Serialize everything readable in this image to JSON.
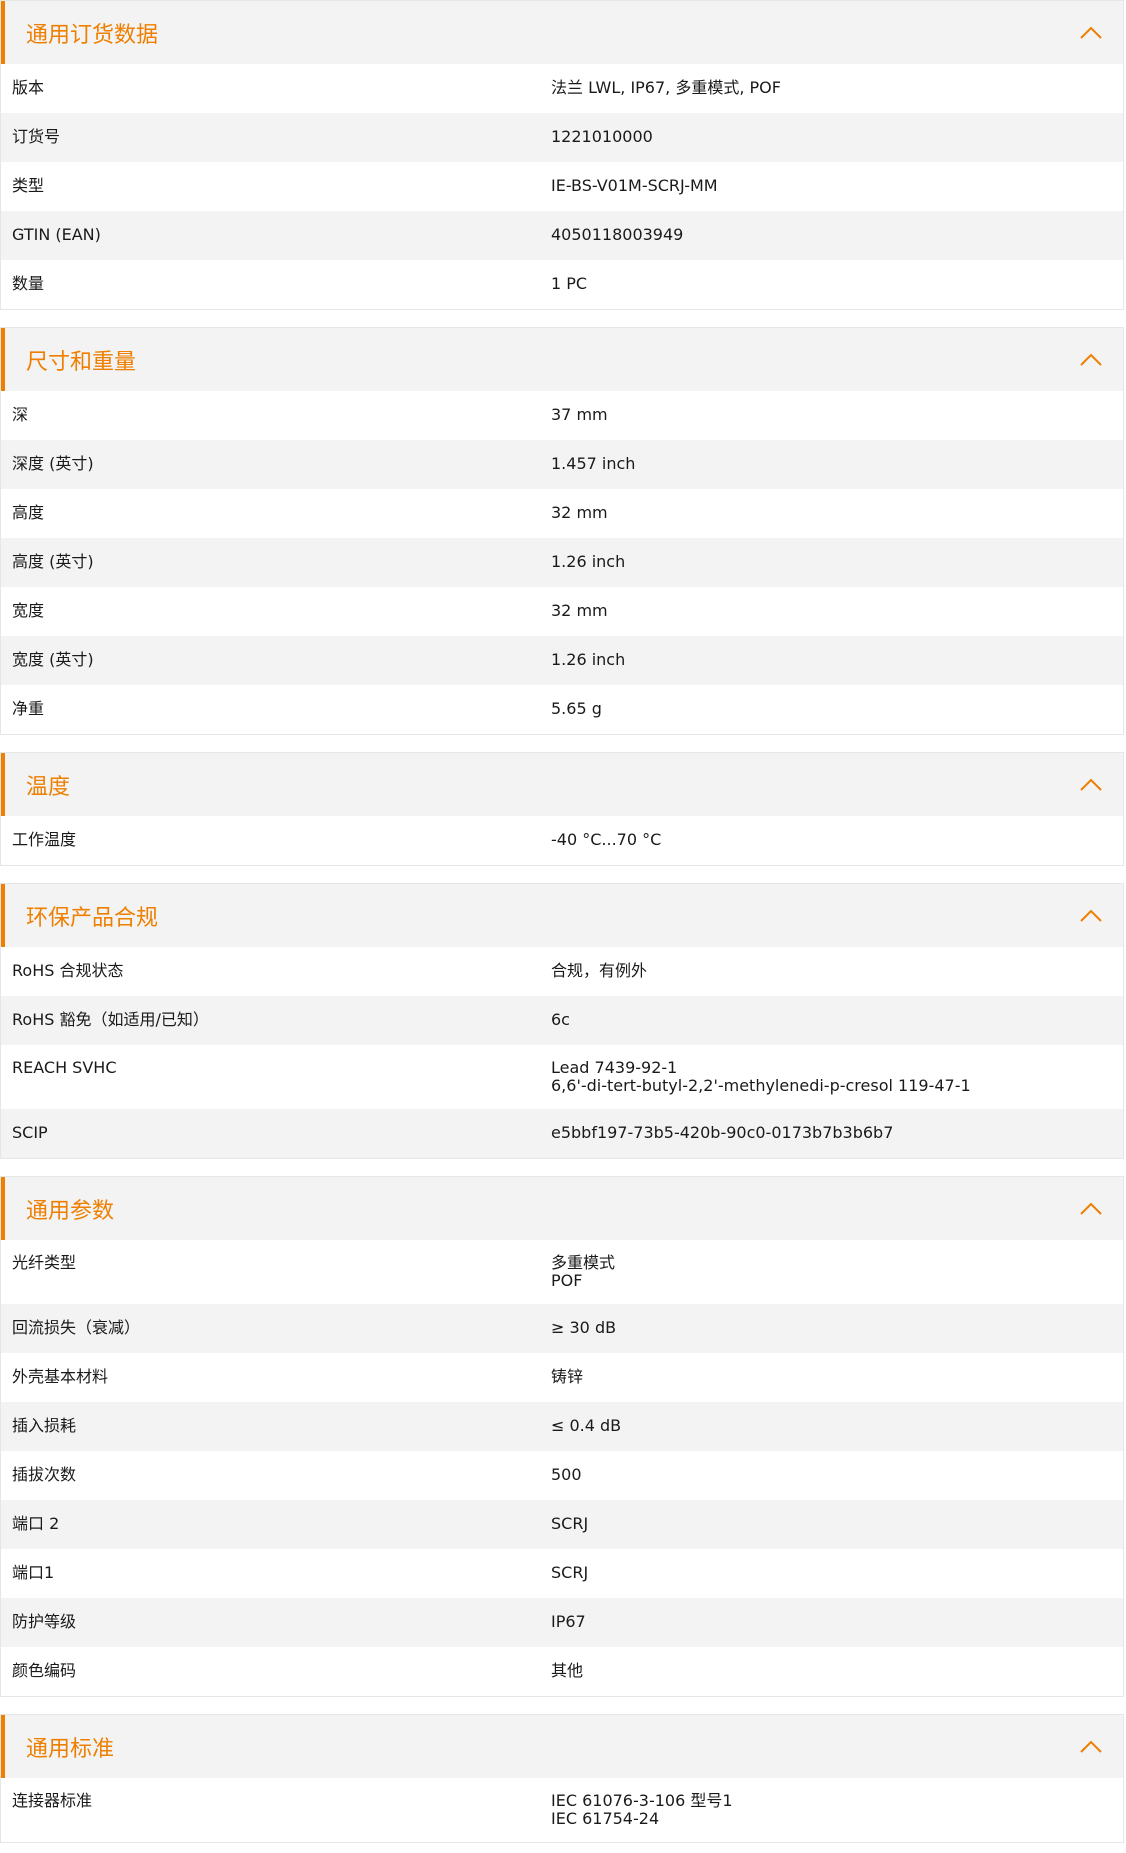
{
  "colors": {
    "accent": "#ee7f00",
    "header_bg": "#f3f3f3",
    "row_alt_bg": "#f3f3f3",
    "border": "#e6e6e6"
  },
  "sections": [
    {
      "title": "通用订货数据",
      "icon": "chevron-up-icon",
      "rows": [
        {
          "label": "版本",
          "values": [
            "法兰 LWL, IP67, 多重模式, POF"
          ]
        },
        {
          "label": "订货号",
          "values": [
            "1221010000"
          ]
        },
        {
          "label": "类型",
          "values": [
            "IE-BS-V01M-SCRJ-MM"
          ]
        },
        {
          "label": "GTIN (EAN)",
          "values": [
            "4050118003949"
          ]
        },
        {
          "label": "数量",
          "values": [
            "1  PC"
          ]
        }
      ]
    },
    {
      "title": "尺寸和重量",
      "icon": "chevron-up-icon",
      "rows": [
        {
          "label": "深",
          "values": [
            "37  mm"
          ]
        },
        {
          "label": "深度 (英寸)",
          "values": [
            "1.457  inch"
          ]
        },
        {
          "label": "高度",
          "values": [
            "32  mm"
          ]
        },
        {
          "label": "高度 (英寸)",
          "values": [
            "1.26  inch"
          ]
        },
        {
          "label": "宽度",
          "values": [
            "32  mm"
          ]
        },
        {
          "label": "宽度 (英寸)",
          "values": [
            "1.26  inch"
          ]
        },
        {
          "label": "净重",
          "values": [
            "5.65  g"
          ]
        }
      ]
    },
    {
      "title": "温度",
      "icon": "chevron-up-icon",
      "rows": [
        {
          "label": "工作温度",
          "values": [
            "-40 °C...70 °C"
          ]
        }
      ]
    },
    {
      "title": "环保产品合规",
      "icon": "chevron-up-icon",
      "rows": [
        {
          "label": "RoHS 合规状态",
          "values": [
            "合规，有例外"
          ]
        },
        {
          "label": "RoHS 豁免（如适用/已知）",
          "values": [
            "6c"
          ]
        },
        {
          "label": "REACH SVHC",
          "values": [
            "Lead 7439-92-1",
            "6,6'-di-tert-butyl-2,2'-methylenedi-p-cresol 119-47-1"
          ]
        },
        {
          "label": "SCIP",
          "values": [
            "e5bbf197-73b5-420b-90c0-0173b7b3b6b7"
          ]
        }
      ]
    },
    {
      "title": "通用参数",
      "icon": "chevron-up-icon",
      "rows": [
        {
          "label": "光纤类型",
          "values": [
            "多重模式",
            "POF"
          ]
        },
        {
          "label": "回流损失（衰减）",
          "values": [
            "≥ 30 dB"
          ]
        },
        {
          "label": "外壳基本材料",
          "values": [
            "铸锌"
          ]
        },
        {
          "label": "插入损耗",
          "values": [
            "≤ 0.4 dB"
          ]
        },
        {
          "label": "插拔次数",
          "values": [
            "500"
          ]
        },
        {
          "label": "端口 2",
          "values": [
            "SCRJ"
          ]
        },
        {
          "label": "端口1",
          "values": [
            "SCRJ"
          ]
        },
        {
          "label": "防护等级",
          "values": [
            "IP67"
          ]
        },
        {
          "label": "颜色编码",
          "values": [
            "其他"
          ]
        }
      ]
    },
    {
      "title": "通用标准",
      "icon": "chevron-up-icon",
      "rows": [
        {
          "label": "连接器标准",
          "values": [
            "IEC 61076-3-106 型号1",
            "IEC 61754-24"
          ]
        }
      ]
    }
  ]
}
